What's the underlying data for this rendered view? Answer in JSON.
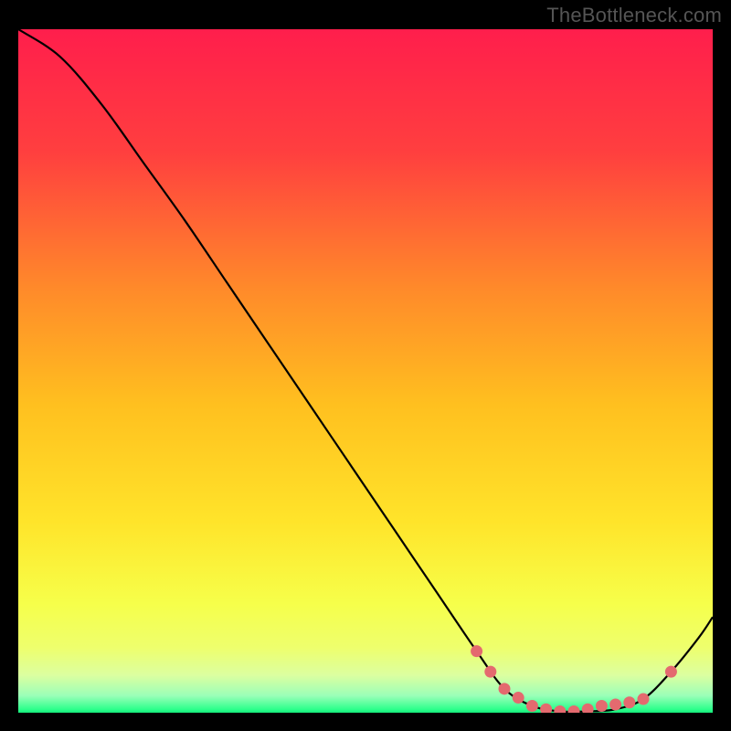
{
  "watermark": "TheBottleneck.com",
  "chart_data": {
    "type": "line",
    "title": "",
    "xlabel": "",
    "ylabel": "",
    "xlim": [
      0,
      100
    ],
    "ylim": [
      0,
      100
    ],
    "grid": false,
    "legend": false,
    "series": [
      {
        "name": "curve",
        "x": [
          0,
          6,
          12,
          18,
          24,
          30,
          36,
          42,
          48,
          54,
          60,
          66,
          70,
          74,
          78,
          82,
          86,
          90,
          94,
          98,
          100
        ],
        "y": [
          100,
          96,
          89,
          80.5,
          72,
          63,
          54,
          45,
          36,
          27,
          18,
          9,
          3.5,
          1,
          0.2,
          0.2,
          0.5,
          2,
          6,
          11,
          14
        ]
      }
    ],
    "markers": {
      "name": "trough-dots-salmon",
      "color": "#e46a6f",
      "x": [
        66,
        68,
        70,
        72,
        74,
        76,
        78,
        80,
        82,
        84,
        86,
        88,
        90,
        94
      ],
      "y": [
        9,
        6,
        3.5,
        2.2,
        1,
        0.5,
        0.2,
        0.2,
        0.5,
        1,
        1.2,
        1.5,
        2,
        6
      ]
    },
    "background_gradient": {
      "stops": [
        {
          "offset": 0.0,
          "color": "#ff1e4c"
        },
        {
          "offset": 0.18,
          "color": "#ff3f3f"
        },
        {
          "offset": 0.38,
          "color": "#ff8a2a"
        },
        {
          "offset": 0.55,
          "color": "#ffc01f"
        },
        {
          "offset": 0.72,
          "color": "#ffe42a"
        },
        {
          "offset": 0.84,
          "color": "#f6ff4a"
        },
        {
          "offset": 0.905,
          "color": "#eeff6d"
        },
        {
          "offset": 0.945,
          "color": "#dcffa0"
        },
        {
          "offset": 0.975,
          "color": "#9bffb8"
        },
        {
          "offset": 0.995,
          "color": "#2dff8c"
        },
        {
          "offset": 1.0,
          "color": "#14e879"
        }
      ]
    }
  }
}
